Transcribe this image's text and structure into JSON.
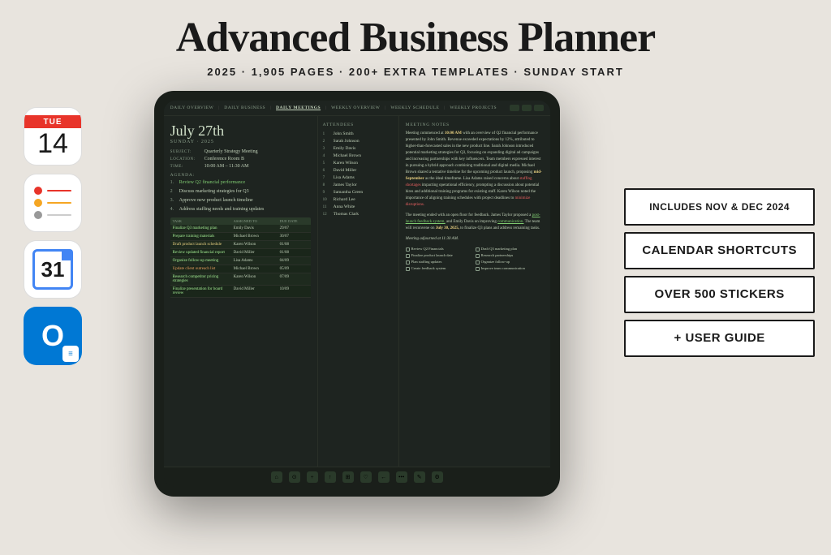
{
  "header": {
    "title": "Advanced Business Planner",
    "subtitle": "2025  ·  1,905 PAGES  ·  200+ EXTRA TEMPLATES  ·  SUNDAY START"
  },
  "calendar_app": {
    "day": "TUE",
    "date": "14"
  },
  "gcal_app": {
    "number": "31"
  },
  "tablet": {
    "nav": {
      "items": [
        "DAILY OVERVIEW",
        "DAILY BUSINESS",
        "DAILY MEETINGS",
        "WEEKLY OVERVIEW",
        "WEEKLY SCHEDULE",
        "WEEKLY PROJECTS"
      ]
    },
    "date": {
      "heading": "July 27th",
      "sub": "SUNDAY · 2025"
    },
    "meeting": {
      "subject_label": "SUBJECT:",
      "subject": "Quarterly Strategy Meeting",
      "location_label": "LOCATION:",
      "location": "Conference Room B",
      "time_label": "TIME:",
      "time": "10:00 AM – 11:30 AM"
    },
    "agenda": {
      "title": "AGENDA:",
      "items": [
        "Review Q2 financial performance",
        "Discuss marketing strategies for Q3",
        "Approve new product launch timeline",
        "Address staffing needs and training updates"
      ]
    },
    "tasks": {
      "headers": [
        "TASK",
        "ASSIGNED TO",
        "DUE DATE"
      ],
      "rows": [
        {
          "name": "Finalize Q3 marketing plan",
          "assigned": "Emily Davis",
          "due": "29/07",
          "color": "green"
        },
        {
          "name": "Prepare training materials",
          "assigned": "Michael Brown",
          "due": "30/07",
          "color": "normal"
        },
        {
          "name": "Draft product launch schedule",
          "assigned": "Karen Wilson",
          "due": "01/08",
          "color": "yellow"
        },
        {
          "name": "Review updated financial report",
          "assigned": "David Miller",
          "due": "01/08",
          "color": "normal"
        },
        {
          "name": "Organize follow-up meeting",
          "assigned": "Lisa Adams",
          "due": "04/09",
          "color": "normal"
        },
        {
          "name": "Update client outreach list",
          "assigned": "Michael Brown",
          "due": "05/09",
          "color": "orange"
        },
        {
          "name": "Research competitor pricing strategies",
          "assigned": "Karen Wilson",
          "due": "07/09",
          "color": "normal"
        },
        {
          "name": "Finalize presentation for board review",
          "assigned": "David Miller",
          "due": "10/09",
          "color": "normal"
        }
      ]
    },
    "attendees": {
      "title": "ATTENDEES",
      "list": [
        "John Smith",
        "Sarah Johnson",
        "Emily Davis",
        "Michael Brown",
        "Karen Wilson",
        "David Miller",
        "Lisa Adams",
        "James Taylor",
        "Samantha Green",
        "Richard Lee",
        "Anna White",
        "Thomas Clark"
      ]
    },
    "notes": {
      "title": "MEETING NOTES",
      "paragraphs": [
        "Meeting commenced at 10:00 AM with an overview of Q2 financial performance presented by John Smith. Revenue exceeded expectations by 12%, attributed to higher-than-forecasted sales in the new product line. Sarah Johnson introduced potential marketing strategies for Q3, focusing on expanding digital ad campaigns and increasing partnerships with key influencers. Team members expressed interest in pursuing a hybrid approach combining traditional and digital media. Michael Brown shared a tentative timeline for the upcoming product launch, proposing mid-September as the ideal timeframe. Lisa Adams raised concerns about staffing shortages impacting operational efficiency, prompting a discussion about potential hires and additional training programs for existing staff. Karen Wilson noted the importance of aligning training schedules with project deadlines to minimize disruptions.",
        "The meeting ended with an open floor for feedback. James Taylor proposed a post-launch feedback system, and Emily Davis on improving communication. The team will reconvene on July 30, 2025, to finalize Q3 plans and address remaining tasks.",
        "Meeting adjourned at 11:30 AM."
      ],
      "checklist": [
        "Review Q2 Financials",
        "Draft Q3 marketing plan",
        "Finalize product launch date",
        "Research partnerships",
        "Plan staffing updates",
        "Organize follow-up",
        "Create feedback system",
        "Improve team communication"
      ]
    }
  },
  "badges": [
    {
      "text": "INCLUDES NOV & DEC 2024"
    },
    {
      "text": "CALENDAR SHORTCUTS"
    },
    {
      "text": "OVER 500 STICKERS"
    },
    {
      "text": "+ USER GUIDE"
    }
  ]
}
